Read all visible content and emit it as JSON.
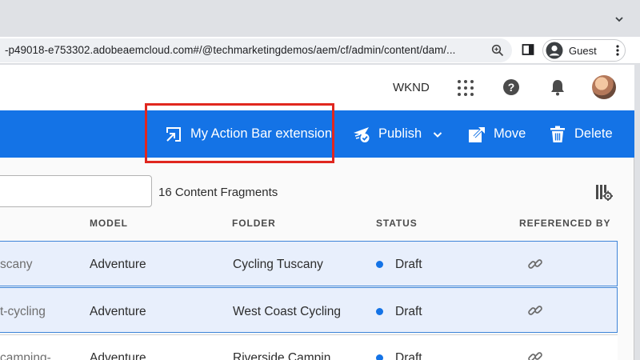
{
  "browser": {
    "url": "-p49018-e753302.adobeaemcloud.com#/@techmarketingdemos/aem/cf/admin/content/dam/...",
    "profile_name": "Guest",
    "icons": [
      "chevron-down-icon",
      "zoom-icon",
      "side-panel-icon",
      "profile-icon",
      "kebab-menu-icon"
    ]
  },
  "shell": {
    "org_name": "WKND",
    "icons": [
      "apps-grid-icon",
      "help-icon",
      "notifications-icon",
      "user-avatar"
    ]
  },
  "action_bar": {
    "color": "#1473e6",
    "actions": [
      {
        "label": "My Action Bar extension",
        "icon": "extension-icon"
      },
      {
        "label": "Publish",
        "icon": "publish-icon"
      },
      {
        "label": "Move",
        "icon": "move-icon"
      },
      {
        "label": "Delete",
        "icon": "delete-icon"
      }
    ],
    "highlight_color": "#e0271f"
  },
  "list": {
    "search_value": "",
    "count_label": "16 Content Fragments",
    "columns": [
      "MODEL",
      "FOLDER",
      "STATUS",
      "REFERENCED BY"
    ],
    "rows": [
      {
        "name": "scany",
        "model": "Adventure",
        "folder": "Cycling Tuscany",
        "status": "Draft",
        "selected": true
      },
      {
        "name": "t-cycling",
        "model": "Adventure",
        "folder": "West Coast Cycling",
        "status": "Draft",
        "selected": true
      },
      {
        "name": "camping-",
        "model": "Adventure",
        "folder": "Riverside Campin",
        "status": "Draft",
        "selected": false
      }
    ]
  }
}
